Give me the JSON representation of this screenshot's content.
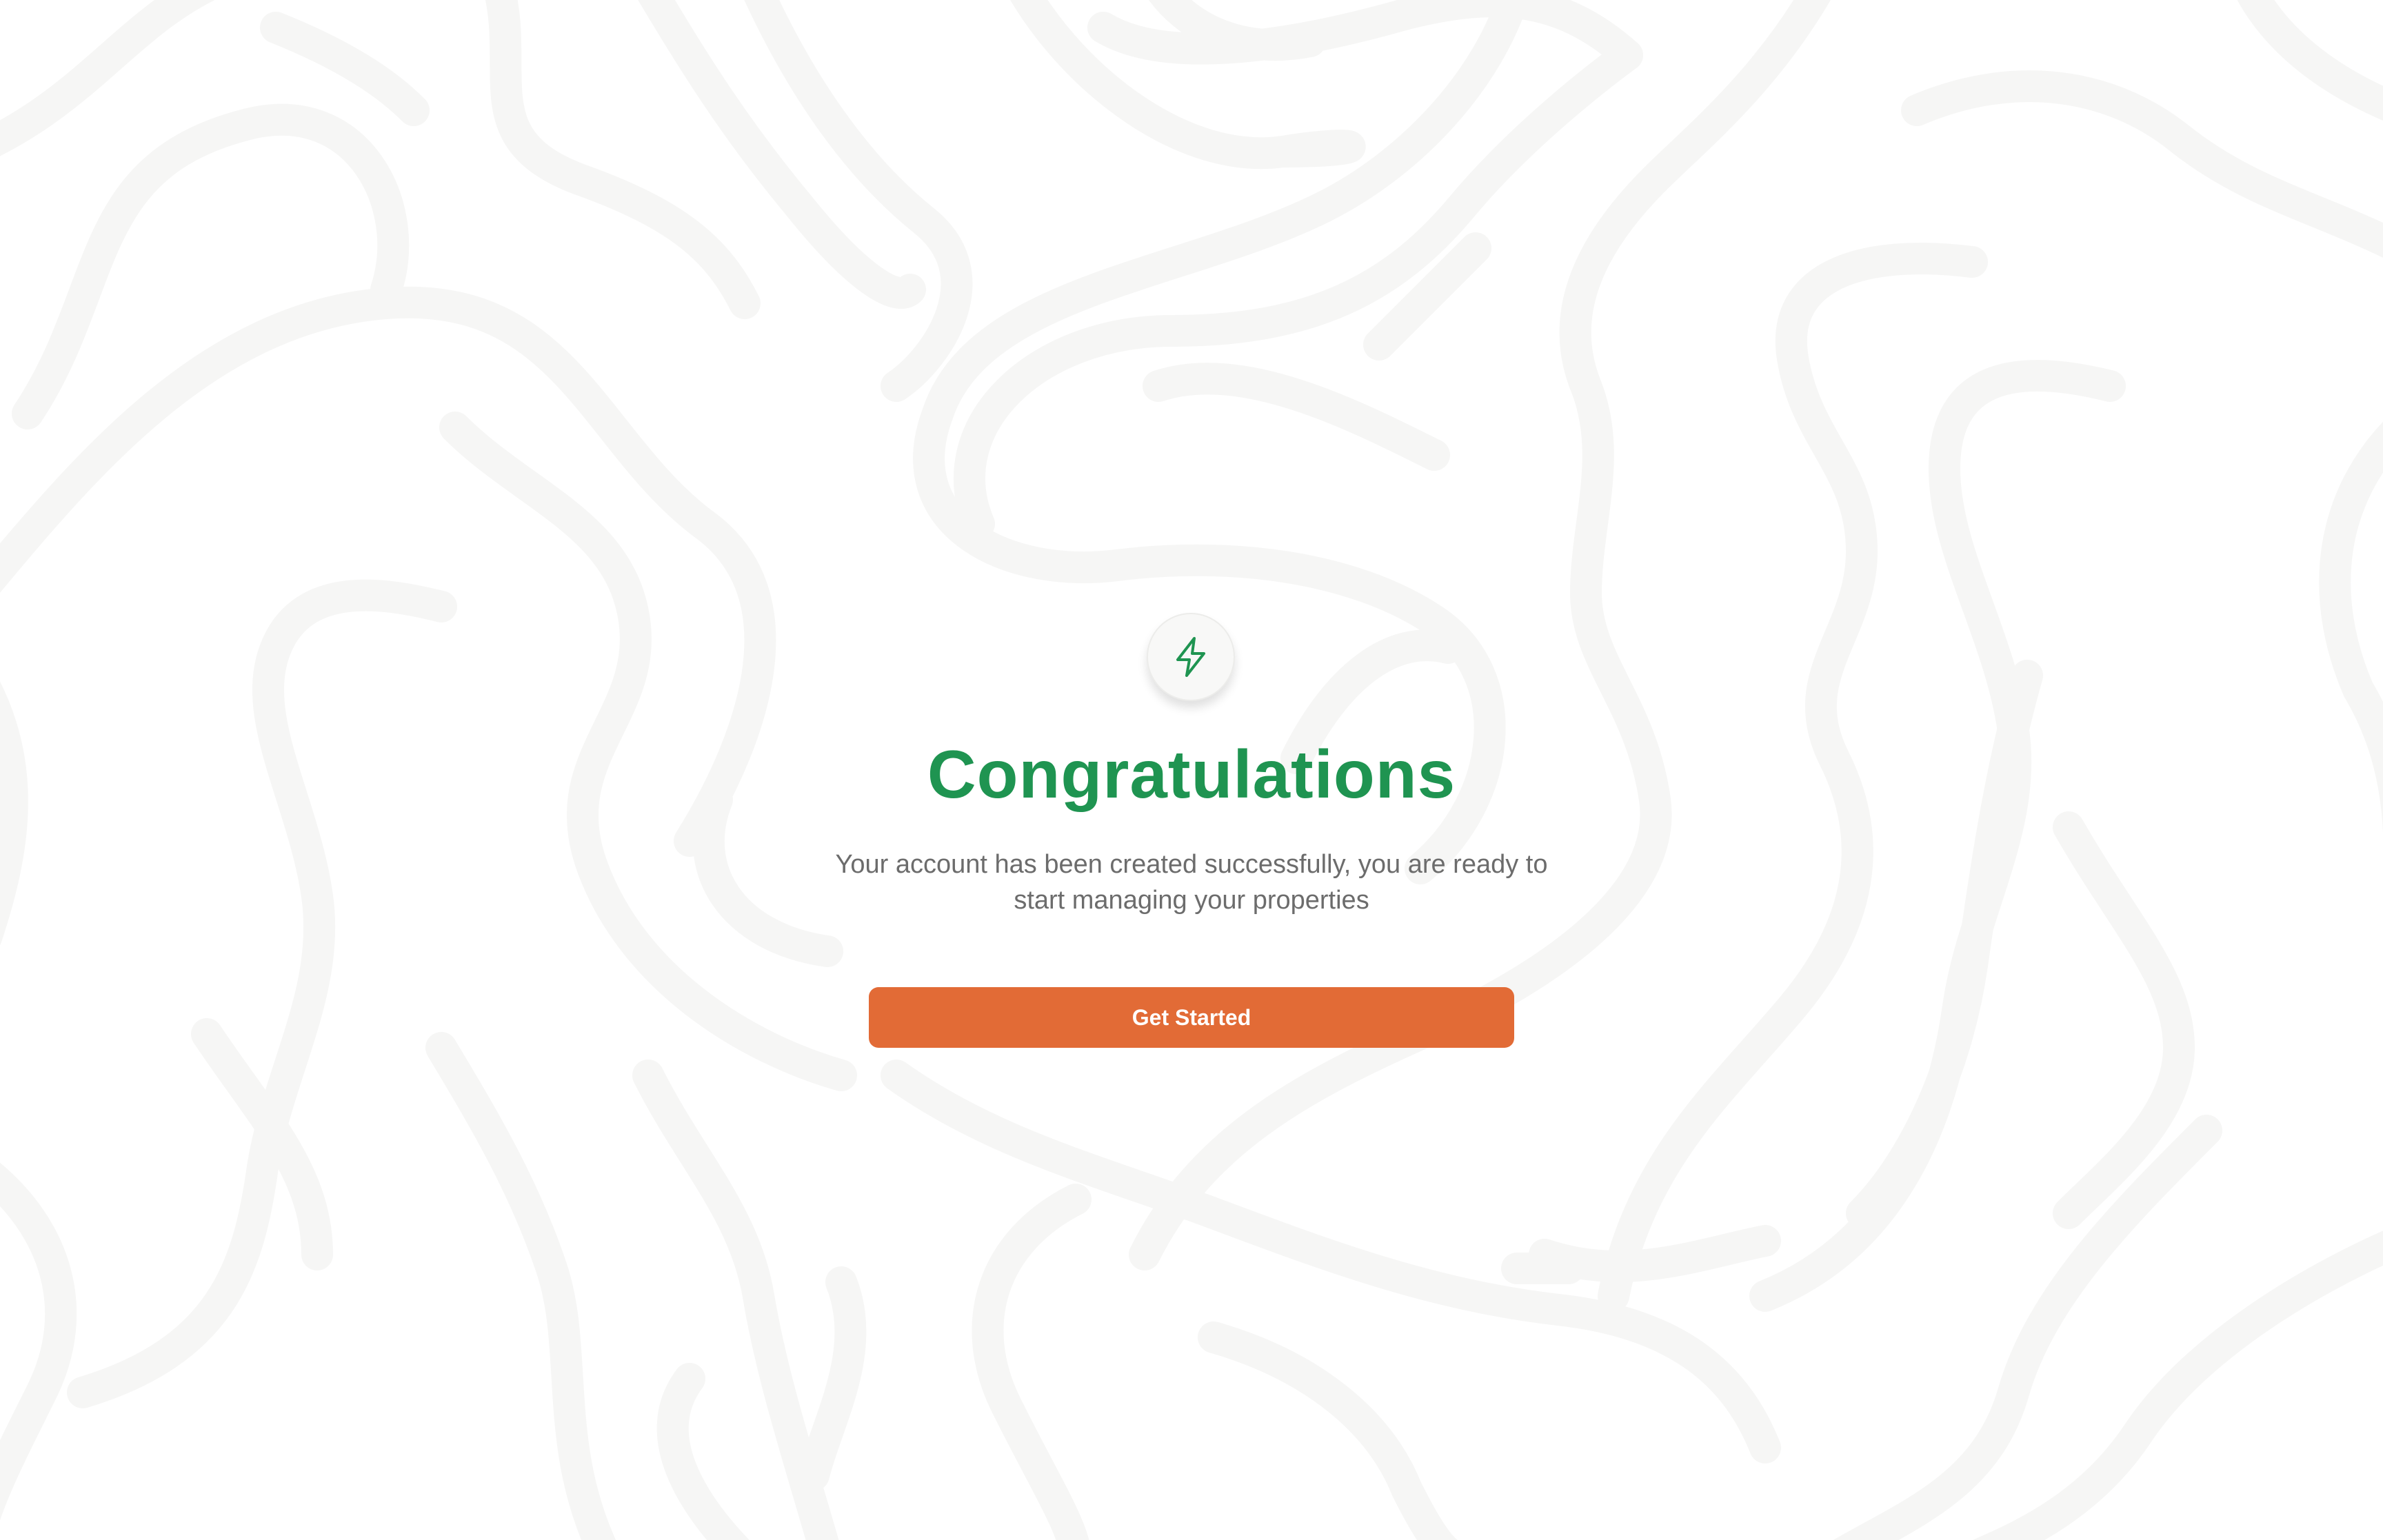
{
  "success": {
    "icon": "lightning-bolt-icon",
    "title": "Congratulations",
    "message": "Your account has been created successfully, you are ready to start managing your properties",
    "button_label": "Get Started"
  },
  "colors": {
    "title_green": "#1f9451",
    "button_orange": "#e26b36",
    "message_gray": "#6c6c6c",
    "background": "#ffffff",
    "pattern": "#f6f6f5"
  }
}
